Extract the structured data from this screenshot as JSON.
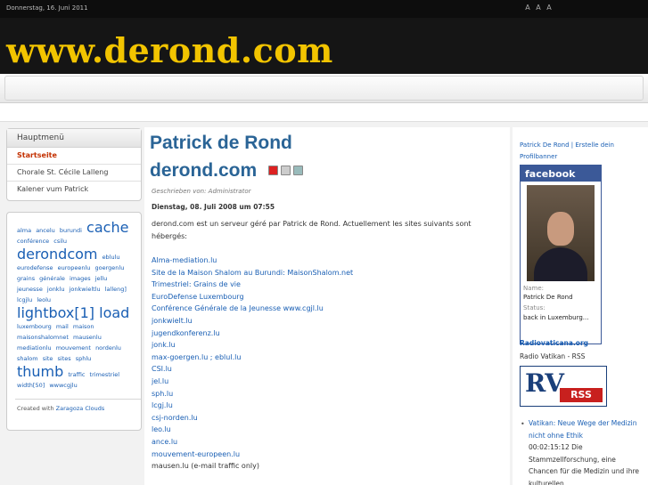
{
  "header": {
    "date": "Donnerstag, 16. Juni 2011",
    "font_controls": [
      "A",
      "A",
      "A"
    ],
    "logo": "www.derond.com"
  },
  "left_menu": {
    "title": "Hauptmenü",
    "items": [
      {
        "label": "Startseite",
        "active": true
      },
      {
        "label": "Chorale St. Cécile Lalleng",
        "active": false
      },
      {
        "label": "Kalener vum Patrick",
        "active": false
      }
    ]
  },
  "tag_cloud": {
    "tags": [
      {
        "t": "alma",
        "s": "small"
      },
      {
        "t": "ancelu",
        "s": "small"
      },
      {
        "t": "burundi",
        "s": "small"
      },
      {
        "t": "cache",
        "s": "big"
      },
      {
        "t": "conférence",
        "s": "small"
      },
      {
        "t": "csilu",
        "s": "small"
      },
      {
        "t": "derondcom",
        "s": "big"
      },
      {
        "t": "eblulu",
        "s": "small"
      },
      {
        "t": "eurodefense",
        "s": "small"
      },
      {
        "t": "europeenlu",
        "s": "small"
      },
      {
        "t": "goergenlu",
        "s": "small"
      },
      {
        "t": "grains",
        "s": "small"
      },
      {
        "t": "générale",
        "s": "small"
      },
      {
        "t": "images",
        "s": "small"
      },
      {
        "t": "jellu",
        "s": "small"
      },
      {
        "t": "jeunesse",
        "s": "small"
      },
      {
        "t": "jonklu",
        "s": "small"
      },
      {
        "t": "jonkwieltlu",
        "s": "small"
      },
      {
        "t": "lalleng]",
        "s": "small"
      },
      {
        "t": "lcgjlu",
        "s": "small"
      },
      {
        "t": "leolu",
        "s": "small"
      },
      {
        "t": "lightbox[1]",
        "s": "big"
      },
      {
        "t": "load",
        "s": "big"
      },
      {
        "t": "luxembourg",
        "s": "small"
      },
      {
        "t": "mail",
        "s": "small"
      },
      {
        "t": "maison",
        "s": "small"
      },
      {
        "t": "maisonshalomnet",
        "s": "small"
      },
      {
        "t": "mausenlu",
        "s": "small"
      },
      {
        "t": "mediationlu",
        "s": "small"
      },
      {
        "t": "mouvement",
        "s": "small"
      },
      {
        "t": "nordenlu",
        "s": "small"
      },
      {
        "t": "shalom",
        "s": "small"
      },
      {
        "t": "site",
        "s": "small"
      },
      {
        "t": "sites",
        "s": "small"
      },
      {
        "t": "sphlu",
        "s": "small"
      },
      {
        "t": "thumb",
        "s": "big"
      },
      {
        "t": "traffic",
        "s": "small"
      },
      {
        "t": "trimestriel",
        "s": "small"
      },
      {
        "t": "width[50]",
        "s": "small"
      },
      {
        "t": "wwwcgjlu",
        "s": "small"
      }
    ],
    "credit_prefix": "Created with",
    "credit_link": "Zaragoza Clouds"
  },
  "article": {
    "title": "Patrick de Rond",
    "subtitle": "derond.com",
    "author": "Geschrieben von: Administrator",
    "date": "Dienstag, 08. Juli 2008 um 07:55",
    "intro": "derond.com est un serveur géré par Patrick de Rond. Actuellement les sites suivants sont hébergés:",
    "sites": [
      {
        "text": "Alma-mediation.lu",
        "link": true
      },
      {
        "text": "Site de la Maison Shalom au Burundi: MaisonShalom.net",
        "link": true
      },
      {
        "text": "Trimestriel: Grains de vie",
        "link": true
      },
      {
        "text": "EuroDefense Luxembourg",
        "link": true
      },
      {
        "text": "Conférence Générale de la Jeunesse www.cgjl.lu",
        "link": true
      },
      {
        "text": "jonkwielt.lu",
        "link": true
      },
      {
        "text": "jugendkonferenz.lu",
        "link": true
      },
      {
        "text": "jonk.lu",
        "link": true
      },
      {
        "text": "max-goergen.lu ; eblul.lu",
        "link": true
      },
      {
        "text": "CSI.lu",
        "link": true
      },
      {
        "text": "jel.lu",
        "link": true
      },
      {
        "text": "sph.lu",
        "link": true
      },
      {
        "text": "lcgj.lu",
        "link": true
      },
      {
        "text": "csj-norden.lu",
        "link": true
      },
      {
        "text": "leo.lu",
        "link": true
      },
      {
        "text": "ance.lu",
        "link": true
      },
      {
        "text": "mouvement-europeen.lu",
        "link": true
      },
      {
        "text": "mausen.lu (e-mail traffic only)",
        "link": false
      }
    ]
  },
  "right": {
    "profile_link": "Patrick De Rond | Erstelle dein Profilbanner",
    "facebook": {
      "brand": "facebook",
      "name_label": "Name:",
      "name": "Patrick De Rond",
      "status_label": "Status:",
      "status": "back in Luxemburg..."
    },
    "rss_title": "Radiovaticana.org",
    "rss_sub": "Radio Vatikan - RSS",
    "rss_logo_rv": "RV",
    "rss_logo_badge": "RSS",
    "news": {
      "link": "Vatikan: Neue Wege der Medizin nicht ohne Ethik",
      "text": "00:02:15:12 Die Stammzellforschung, eine Chancen für die Medizin und ihre kulturellen"
    }
  },
  "colors": {
    "logo": "#f2c400",
    "link": "#1a5fb4",
    "heading": "#2a6496",
    "active": "#c33000",
    "facebook": "#3b5998"
  }
}
